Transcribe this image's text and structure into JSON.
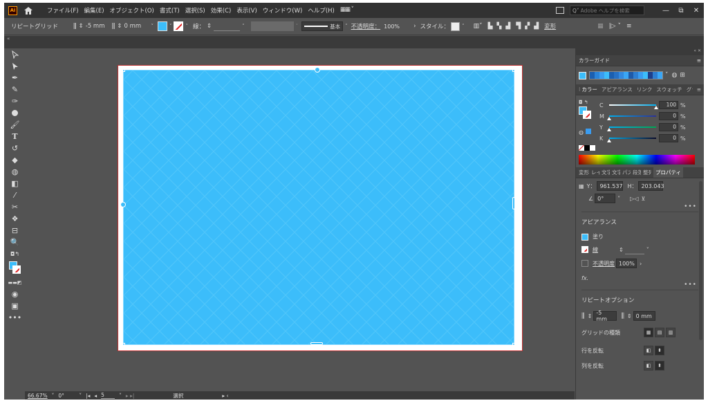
{
  "menubar": {
    "logo": "Ai",
    "menus": [
      "ファイル(F)",
      "編集(E)",
      "オブジェクト(O)",
      "書式(T)",
      "選択(S)",
      "効果(C)",
      "表示(V)",
      "ウィンドウ(W)",
      "ヘルプ(H)"
    ],
    "search_placeholder": "Adobe ヘルプを検索"
  },
  "control": {
    "object_name": "リピートグリッド",
    "h_spacing": "-5 mm",
    "v_spacing": "0 mm",
    "stroke_label": "線：",
    "stroke_profile": "基本",
    "opacity_label": "不透明度：",
    "opacity_value": "100%",
    "style_label": "スタイル：",
    "transform_label": "変形"
  },
  "status": {
    "zoom": "66.67%",
    "rotation": "0°",
    "artboard": "5",
    "mode": "選択"
  },
  "colors": {
    "fill": "#3cbdfa",
    "accent": "#ff9a00"
  },
  "color_guide": {
    "title": "カラーガイド"
  },
  "color_panel": {
    "tabs": [
      "カラー",
      "アピアランス",
      "リンク",
      "スウォッチ",
      "グラデーション"
    ],
    "channels": [
      {
        "label": "C",
        "value": "100",
        "unit": "%"
      },
      {
        "label": "M",
        "value": "0",
        "unit": "%"
      },
      {
        "label": "Y",
        "value": "0",
        "unit": "%"
      },
      {
        "label": "K",
        "value": "0",
        "unit": "%"
      }
    ]
  },
  "props": {
    "tabs": [
      "変形",
      "レイヤー",
      "文字",
      "文字",
      "パス",
      "段落",
      "整列",
      "プロパティ"
    ],
    "y_label": "Y：",
    "y_value": "961.537",
    "h_label": "H：",
    "h_value": "203.043",
    "angle": "0°",
    "appearance_title": "アピアランス",
    "fill_label": "塗り",
    "stroke_label": "線",
    "opacity_label": "不透明度",
    "opacity_value": "100%",
    "fx": "fx.",
    "repeat_title": "リピートオプション",
    "h_spacing": "-5 mm",
    "v_spacing": "0 mm",
    "grid_type_label": "グリッドの種類",
    "flip_row_label": "行を反転",
    "flip_col_label": "列を反転"
  },
  "icons": [
    "home-icon",
    "search-icon",
    "minimize-icon",
    "maximize-icon",
    "close-icon",
    "selection-tool-icon",
    "direct-selection-icon",
    "pen-icon",
    "curvature-icon",
    "ellipse-icon",
    "paintbrush-icon",
    "type-icon",
    "rotate-icon",
    "eraser-icon",
    "zoom-icon"
  ]
}
